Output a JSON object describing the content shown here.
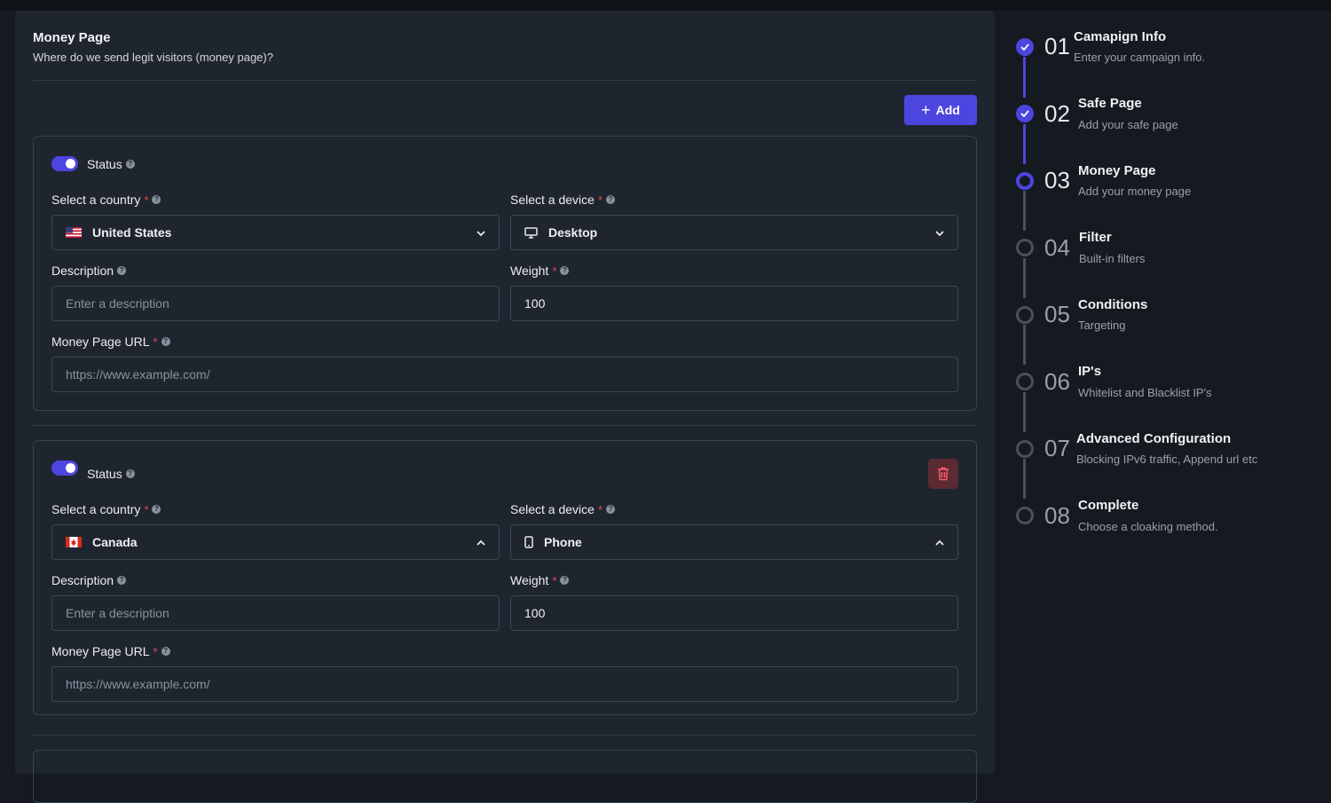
{
  "section": {
    "title": "Money Page",
    "subtitle": "Where do we send legit visitors (money page)?",
    "add_label": "Add"
  },
  "labels": {
    "status": "Status",
    "country": "Select a country",
    "device": "Select a device",
    "description": "Description",
    "weight": "Weight",
    "url": "Money Page URL",
    "required_mark": "*",
    "help_mark": "?"
  },
  "entries": [
    {
      "status_on": true,
      "country": "United States",
      "country_flag": "us-flag-icon",
      "device": "Desktop",
      "device_icon": "desktop-icon",
      "dropdown_open": false,
      "description_placeholder": "Enter a description",
      "weight": "100",
      "url_placeholder": "https://www.example.com/"
    },
    {
      "status_on": true,
      "country": "Canada",
      "country_flag": "canada-flag-icon",
      "device": "Phone",
      "device_icon": "phone-icon",
      "dropdown_open": true,
      "description_placeholder": "Enter a description",
      "weight": "100",
      "url_placeholder": "https://www.example.com/"
    }
  ],
  "steps": [
    {
      "num": "01",
      "title": "Camapign Info",
      "desc": "Enter your campaign info.",
      "state": "done"
    },
    {
      "num": "02",
      "title": "Safe Page",
      "desc": "Add your safe page",
      "state": "done"
    },
    {
      "num": "03",
      "title": "Money Page",
      "desc": "Add your money page",
      "state": "current"
    },
    {
      "num": "04",
      "title": "Filter",
      "desc": "Built-in filters",
      "state": "pending"
    },
    {
      "num": "05",
      "title": "Conditions",
      "desc": "Targeting",
      "state": "pending"
    },
    {
      "num": "06",
      "title": "IP's",
      "desc": "Whitelist and Blacklist IP's",
      "state": "pending"
    },
    {
      "num": "07",
      "title": "Advanced Configuration",
      "desc": "Blocking IPv6 traffic, Append url etc",
      "state": "pending"
    },
    {
      "num": "08",
      "title": "Complete",
      "desc": "Choose a cloaking method.",
      "state": "pending"
    }
  ],
  "colors": {
    "accent": "#4c45e0",
    "danger": "#e5484d",
    "delete_bg": "#5b2a33"
  }
}
